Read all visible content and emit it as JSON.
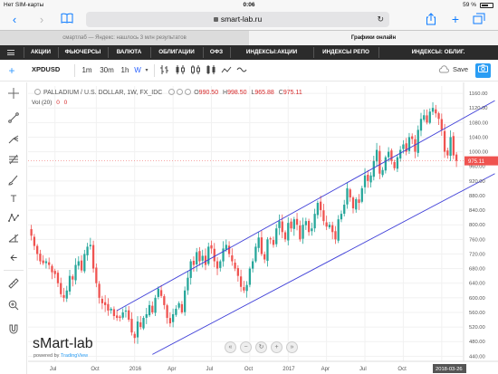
{
  "status_bar": {
    "carrier": "Нет SIM-карты",
    "time": "0:06",
    "battery": "59 %"
  },
  "safari": {
    "url": "smart-lab.ru"
  },
  "browser_tabs": [
    {
      "label": "смартлаб — Яндекс: нашлось 3 млн результатов",
      "active": false
    },
    {
      "label": "Графики онлайн",
      "active": true
    }
  ],
  "site_nav": [
    "АКЦИИ",
    "ФЬЮЧЕРСЫ",
    "ВАЛЮТА",
    "ОБЛИГАЦИИ",
    "ОФЗ",
    "ИНДЕКСЫ:АКЦИИ",
    "ИНДЕКСЫ РЕПО",
    "ИНДЕКСЫ: ОБЛИГ."
  ],
  "toolbar": {
    "symbol": "XPDUSD",
    "timeframes": [
      "1m",
      "30m",
      "1h",
      "W"
    ],
    "active_timeframe": "W",
    "save_label": "Save"
  },
  "legend": {
    "title": "PALLADIUM / U.S. DOLLAR, 1W, FX_IDC",
    "open_key": "O",
    "open": "990.50",
    "high_key": "H",
    "high": "998.50",
    "low_key": "L",
    "low": "965.88",
    "close_key": "C",
    "close": "975.11",
    "volume_label": "Vol (20)",
    "volume_value_1": "0",
    "volume_value_2": "0"
  },
  "branding": {
    "watermark": "sMart-lab",
    "powered_prefix": "powered by",
    "powered_brand": "TradingView"
  },
  "colors": {
    "up": "#26a69a",
    "down": "#ef5350",
    "channel": "#3f3fd8",
    "accent": "#2962ff",
    "price_label": "#ef5350"
  },
  "chart_data": {
    "type": "candlestick",
    "symbol": "XPDUSD",
    "title": "PALLADIUM / U.S. DOLLAR, 1W, FX_IDC",
    "last_price": 975.11,
    "last_price_label": "975.11",
    "date_label": "2018-03-26",
    "y_ticks": [
      440,
      480,
      520,
      560,
      600,
      640,
      680,
      720,
      760,
      800,
      840,
      880,
      920,
      960,
      1000,
      1040,
      1080,
      1120,
      1160
    ],
    "y_tick_labels": [
      "440.00",
      "480.00",
      "520.00",
      "560.00",
      "600.00",
      "640.00",
      "680.00",
      "720.00",
      "760.00",
      "800.00",
      "840.00",
      "880.00",
      "920.00",
      "960.00",
      "1000.00",
      "1040.00",
      "1080.00",
      "1120.00",
      "1160.00"
    ],
    "ylim": [
      426,
      1180
    ],
    "x_labels": [
      "Jul",
      "Oct",
      "2016",
      "Apr",
      "Jul",
      "Oct",
      "2017",
      "Apr",
      "Jul",
      "Oct",
      "2018"
    ],
    "x_label_weeks": [
      8,
      22,
      35,
      48,
      61,
      74,
      87,
      100,
      113,
      126,
      139
    ],
    "channel_upper": {
      "start_week": 29,
      "start_price": 565,
      "end_week": 157,
      "end_price": 1140
    },
    "channel_lower": {
      "start_week": 41,
      "start_price": 445,
      "end_week": 157,
      "end_price": 940
    },
    "closes": [
      770,
      742,
      720,
      700,
      695,
      700,
      690,
      670,
      665,
      640,
      610,
      600,
      620,
      660,
      650,
      690,
      700,
      675,
      720,
      740,
      745,
      680,
      640,
      600,
      585,
      580,
      565,
      570,
      550,
      545,
      545,
      560,
      565,
      540,
      505,
      490,
      535,
      520,
      545,
      555,
      580,
      560,
      600,
      625,
      605,
      580,
      545,
      530,
      555,
      570,
      585,
      560,
      620,
      655,
      700,
      690,
      725,
      700,
      715,
      690,
      740,
      735,
      700,
      680,
      700,
      735,
      745,
      720,
      700,
      680,
      660,
      630,
      620,
      635,
      680,
      700,
      740,
      765,
      720,
      705,
      760,
      760,
      745,
      790,
      810,
      780,
      760,
      805,
      790,
      815,
      800,
      760,
      800,
      810,
      780,
      790,
      830,
      860,
      840,
      810,
      795,
      800,
      780,
      760,
      815,
      830,
      855,
      900,
      875,
      845,
      870,
      860,
      900,
      935,
      920,
      935,
      975,
      1005,
      940,
      950,
      985,
      1000,
      975,
      955,
      985,
      1005,
      1020,
      1000,
      1040,
      1035,
      1000,
      1060,
      1090,
      1100,
      1080,
      1110,
      1120,
      1105,
      1090,
      1060,
      1000,
      990,
      1040,
      990,
      975
    ]
  }
}
